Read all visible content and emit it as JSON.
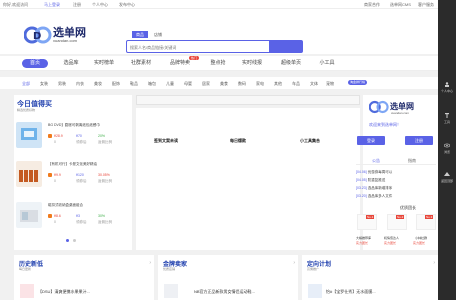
{
  "topbar": {
    "greeting": "你好,欢迎访问",
    "login": "马上登录",
    "register": "注册",
    "profile": "个人中心",
    "post": "发布中心",
    "partner": "商家合作",
    "cms": "选单网CMS",
    "service": "客户服务"
  },
  "logo": {
    "name": "选单网",
    "url": "xuandan.com"
  },
  "search": {
    "tabs": [
      "商品",
      "店铺"
    ],
    "placeholder": "搜索人名/商品链接/关键词"
  },
  "nav": {
    "items": [
      "首页",
      "选品库",
      "实时榜单",
      "社群素材",
      "品牌特卖",
      "整点抢",
      "实时线报",
      "超级单页",
      "小工具"
    ],
    "badge": "热门"
  },
  "cats": {
    "items": [
      "全部",
      "女装",
      "男装",
      "内衣",
      "美妆",
      "配饰",
      "鞋品",
      "箱包",
      "儿童",
      "母婴",
      "居家",
      "美食",
      "数码",
      "家电",
      "其他",
      "车品",
      "文体",
      "宠物"
    ],
    "tag": "淘金排行榜"
  },
  "deals": {
    "title": "今日值得买",
    "subtitle": "精选优质好物",
    "items": [
      {
        "title": "BG DVD】膨胀可剥离纸包纸餐巾",
        "price": "¥28.9",
        "coupon": "¥70",
        "rate": "20%",
        "coupon_label": "领券后",
        "sales": "0",
        "rate_label": "返佣比例"
      },
      {
        "title": "【有机可行】卡曼文化美好精油",
        "price": "¥9.9",
        "coupon": "¥120",
        "rate": "30.05%",
        "coupon_label": "领券后",
        "sales": "0",
        "rate_label": "返佣比例"
      },
      {
        "title": "磁扣式收纳盒桌面组合",
        "price": "¥8.6",
        "coupon": "¥3",
        "rate": "30%",
        "coupon_label": "领券后",
        "sales": "0",
        "rate_label": "返佣比例"
      }
    ]
  },
  "mid": {
    "a": "签到文案未读",
    "b": "每日爆款",
    "c": "小工具集合"
  },
  "welcome": {
    "text": "欢迎来到选单网！",
    "login": "登录",
    "register": "注册",
    "tab_notice": "公告",
    "tab_guide": "指南"
  },
  "notices": [
    {
      "tag": "[04.06]",
      "text": "优惠券每周可以"
    },
    {
      "tag": "[04.05]",
      "text": "防重复推送"
    },
    {
      "tag": "[03.23]",
      "text": "选品库新增排序"
    },
    {
      "tag": "[03.20]",
      "text": "选品库多人文件"
    }
  ],
  "ad": {
    "title": "优质团长",
    "items": [
      {
        "name": "大橘推荐库",
        "score": "实力团长",
        "tag": "No.1"
      },
      {
        "name": "机情值达人",
        "score": "实力团长",
        "tag": "No.2"
      },
      {
        "name": "小林社群",
        "score": "实力团长",
        "tag": "No.3"
      }
    ]
  },
  "sections": [
    {
      "title": "历史新低",
      "subtitle": "每日更新",
      "row": "【DSU】清爽便携水果果汁..."
    },
    {
      "title": "金牌卖家",
      "subtitle": "优质店铺",
      "row": "NB官方正品新款男女情侣运动鞋..."
    },
    {
      "title": "定向计划",
      "subtitle": "高佣推广",
      "row": "怡#【宝罗仕秀】无水面膜..."
    }
  ],
  "sidebar": {
    "items": [
      "个人中心",
      "工具",
      "浏览",
      "返回顶部"
    ]
  },
  "colors": {
    "accent": "#5a62e6",
    "red": "#e8463a",
    "dark": "#2b2b2b"
  }
}
